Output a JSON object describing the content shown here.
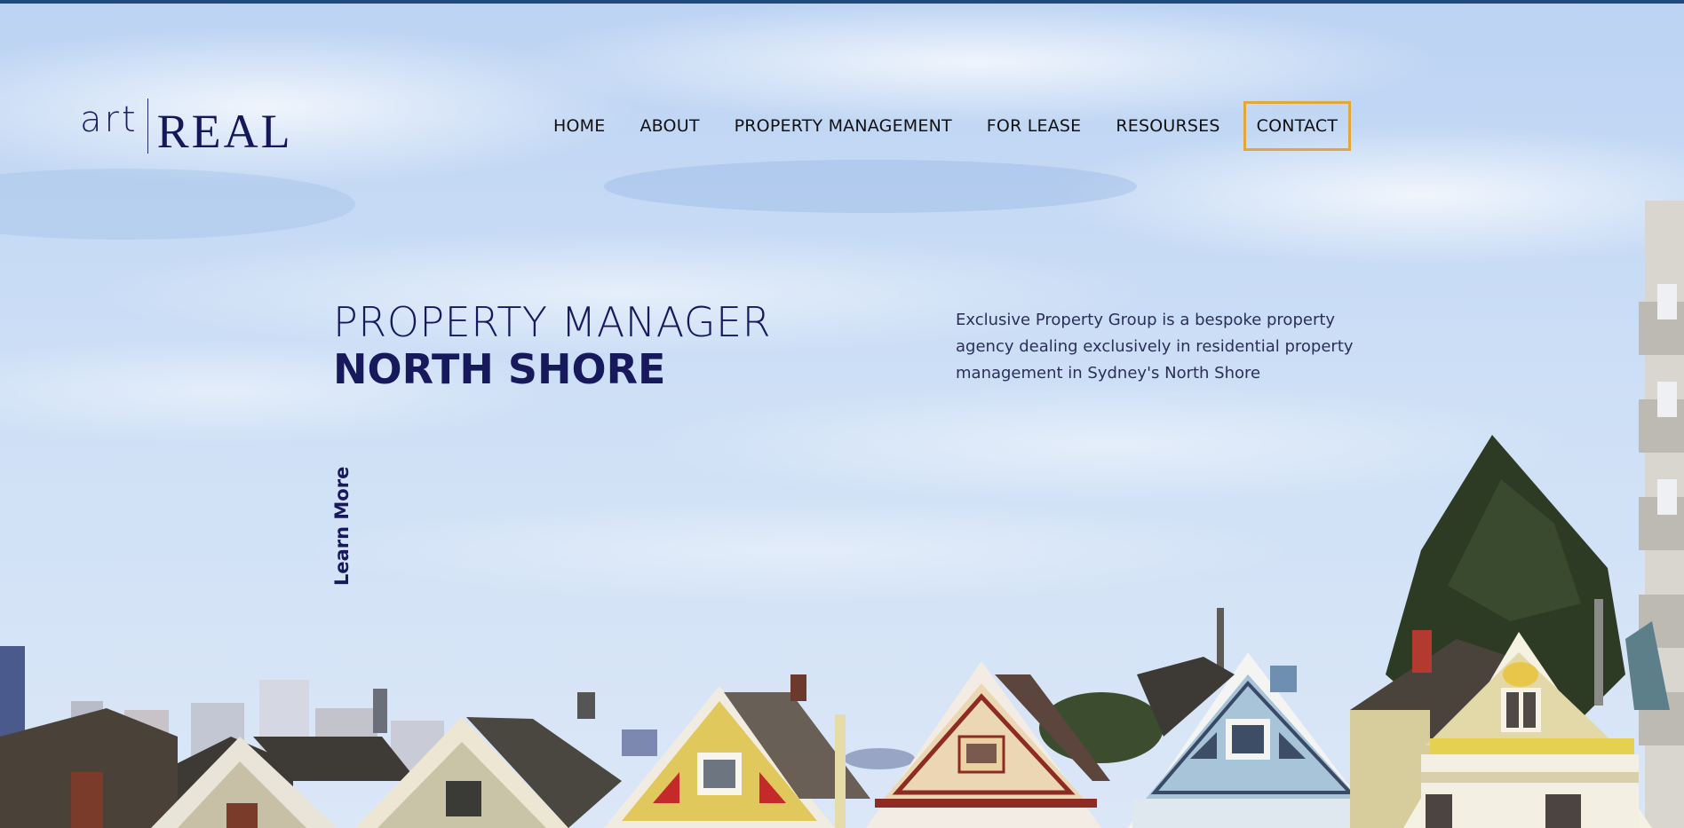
{
  "brand": {
    "logo_light": "art",
    "logo_bold": "REAL"
  },
  "nav": {
    "items": [
      {
        "label": "HOME"
      },
      {
        "label": "ABOUT"
      },
      {
        "label": "PROPERTY MANAGEMENT"
      },
      {
        "label": "FOR LEASE"
      },
      {
        "label": "RESOURSES"
      },
      {
        "label": "CONTACT"
      }
    ]
  },
  "hero": {
    "headline_line1": "PROPERTY MANAGER",
    "headline_line2": "NORTH SHORE",
    "intro": "Exclusive Property Group is a bespoke property agency dealing exclusively in residential property management in Sydney's North Shore",
    "learn_more": "Learn More"
  },
  "colors": {
    "accent_border": "#e0a83b",
    "brand_navy": "#14175a",
    "top_bar": "#1f4a7a"
  }
}
